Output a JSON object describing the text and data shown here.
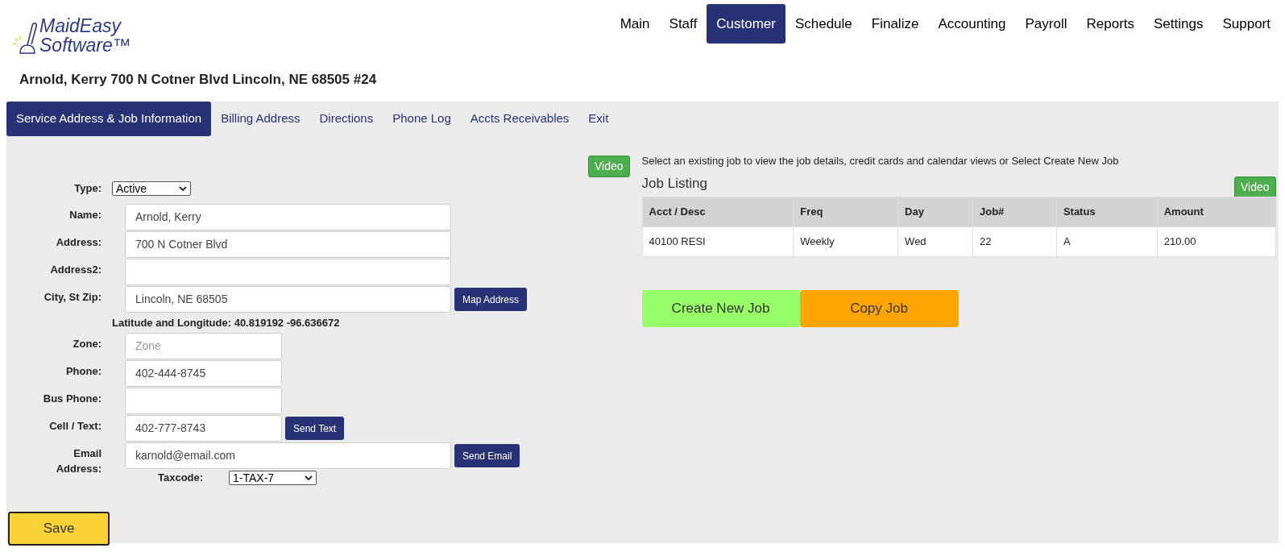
{
  "logo": {
    "line1": "MaidEasy",
    "line2": "Software™"
  },
  "nav": [
    {
      "label": "Main",
      "selected": false
    },
    {
      "label": "Staff",
      "selected": false
    },
    {
      "label": "Customer",
      "selected": true
    },
    {
      "label": "Schedule",
      "selected": false
    },
    {
      "label": "Finalize",
      "selected": false
    },
    {
      "label": "Accounting",
      "selected": false
    },
    {
      "label": "Payroll",
      "selected": false
    },
    {
      "label": "Reports",
      "selected": false
    },
    {
      "label": "Settings",
      "selected": false
    },
    {
      "label": "Support",
      "selected": false
    }
  ],
  "customer_title": "Arnold, Kerry 700 N Cotner Blvd Lincoln, NE 68505 #24",
  "tabs": [
    {
      "label": "Service Address & Job Information",
      "selected": true
    },
    {
      "label": "Billing Address",
      "selected": false
    },
    {
      "label": "Directions",
      "selected": false
    },
    {
      "label": "Phone Log",
      "selected": false
    },
    {
      "label": "Accts Receivables",
      "selected": false
    },
    {
      "label": "Exit",
      "selected": false
    }
  ],
  "form": {
    "video_button": "Video",
    "rows": [
      {
        "kind": "select",
        "label": "Type:",
        "value": "Active"
      },
      {
        "kind": "long_input",
        "label": "Name:",
        "value": "Arnold, Kerry"
      },
      {
        "kind": "long_input",
        "label": "Address:",
        "value": "700 N Cotner Blvd"
      },
      {
        "kind": "long_input",
        "label": "Address2:"
      },
      {
        "kind": "long_input",
        "label": "City, St Zip:",
        "value": "Lincoln, NE 68505",
        "action": "Map Address"
      },
      {
        "kind": "note",
        "text": "Latitude and Longitude: 40.819192 -96.636672"
      },
      {
        "kind": "short_input",
        "label": "Zone:",
        "placeholder": "Zone"
      },
      {
        "kind": "short_input",
        "label": "Phone:",
        "value": "402-444-8745"
      },
      {
        "kind": "short_input",
        "label": "Bus Phone:"
      },
      {
        "kind": "short_input",
        "label": "Cell / Text:",
        "value": "402-777-8743",
        "action": "Send Text"
      },
      {
        "kind": "long_input",
        "label": "Email Address:",
        "value": "karnold@email.com",
        "action": "Send Email"
      },
      {
        "kind": "inline_select",
        "label": "Taxcode:",
        "value": "1-TAX-7"
      }
    ],
    "save_button": "Save"
  },
  "jobs": {
    "instructions": "Select an existing job to view the job details, credit cards and calendar views or Select Create New Job",
    "heading": "Job Listing",
    "video_button": "Video",
    "table": {
      "columns": [
        "Acct / Desc",
        "Freq",
        "Day",
        "Job#",
        "Status",
        "Amount"
      ],
      "rows": [
        [
          "40100 RESI",
          "Weekly",
          "Wed",
          "22",
          "A",
          "210.00"
        ]
      ]
    },
    "create_button": "Create New Job",
    "copy_button": "Copy Job"
  }
}
